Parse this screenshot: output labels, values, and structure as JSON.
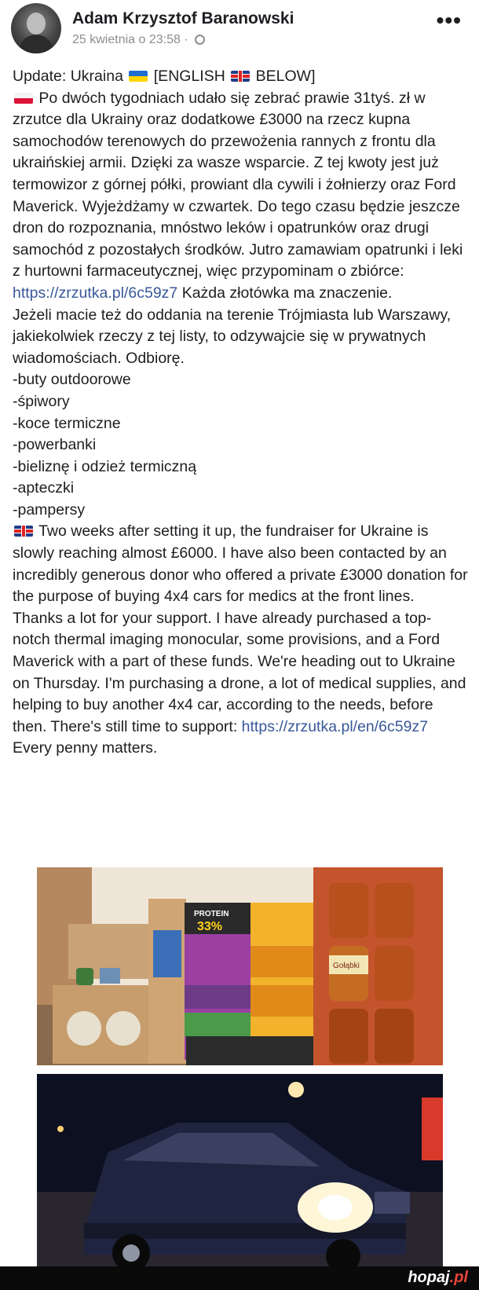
{
  "header": {
    "author": "Adam Krzysztof Baranowski",
    "timestamp": "25 kwietnia o 23:58 ·",
    "privacy_icon": "globe-icon",
    "more_label": "•••"
  },
  "post": {
    "title_left": "Update: Ukraina",
    "title_mid": "[ENGLISH",
    "title_right": "BELOW]",
    "pl_p1a": "Po dwóch tygodniach udało się zebrać prawie 31tyś. zł w zrzutce dla Ukrainy oraz dodatkowe £3000 na rzecz kupna samochodów terenowych do przewożenia rannych z frontu dla ukraińskiej armii. Dzięki za wasze wsparcie. Z tej kwoty jest już termowizor z górnej półki, prowiant dla cywili i żołnierzy oraz Ford Maverick. Wyjeżdżamy w czwartek. Do tego czasu będzie jeszcze dron do rozpoznania, mnóstwo leków i opatrunków oraz drugi samochód z pozostałych środków. Jutro zamawiam opatrunki i leki z hurtowni farmaceutycznej, więc przypominam o zbiórce:",
    "pl_link": "https://zrzutka.pl/6c59z7",
    "pl_p1b": "Każda złotówka ma znaczenie.",
    "pl_p2": "Jeżeli macie też do oddania na terenie Trójmiasta lub Warszawy, jakiekolwiek rzeczy z tej listy, to odzywajcie się w prywatnych wiadomościach. Odbiorę.",
    "items": [
      "-buty outdoorowe",
      "-śpiwory",
      "-koce termiczne",
      "-powerbanki",
      "-bieliznę i odzież termiczną",
      "-apteczki",
      "-pampersy"
    ],
    "en_text": "Two weeks after setting it up, the fundraiser for Ukraine is slowly reaching almost £6000. I have also been contacted by an incredibly generous donor who offered a private £3000 donation for the purpose of buying 4x4 cars for medics at the front lines. Thanks a lot for your support. I have already purchased a top-notch thermal imaging monocular, some provisions, and a Ford Maverick with a part of these funds. We're heading out to Ukraine on Thursday. I'm purchasing a drone, a lot of medical supplies, and helping to buy another 4x4 car, according to the needs, before then. There's still time to support:",
    "en_link": "https://zrzutka.pl/en/6c59z7",
    "en_tail": "Every penny matters."
  },
  "photo1": {
    "box_label_1": "PROTEIN",
    "box_label_2": "33%",
    "jar_label": "Gołąbki"
  },
  "footer": {
    "brand_main": "hopaj",
    "brand_tld": ".pl"
  },
  "colors": {
    "link": "#385898",
    "text": "#1c1e21",
    "meta": "#8a8d91",
    "footer_bg": "#0a0a0a",
    "brand_dot": "#e8453c"
  }
}
